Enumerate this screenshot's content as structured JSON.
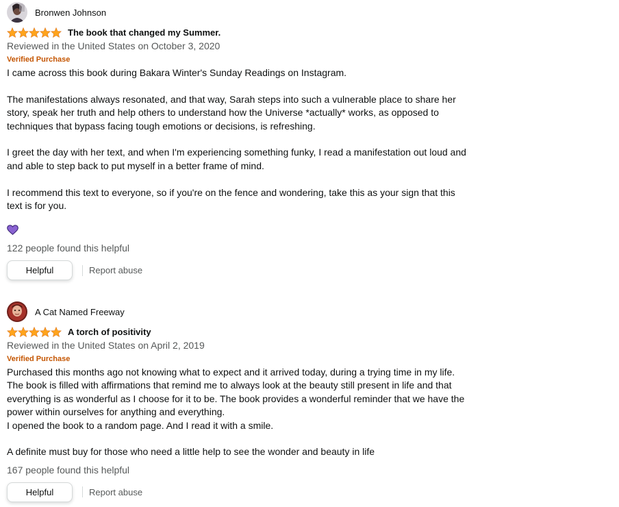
{
  "reviews": [
    {
      "reviewer": "Bronwen Johnson",
      "title": "The book that changed my Summer.",
      "rating": 5,
      "date": "Reviewed in the United States on October 3, 2020",
      "verified": "Verified Purchase",
      "paragraphs": [
        "I came across this book during Bakara Winter's Sunday Readings on Instagram.",
        "The manifestations always resonated, and that way, Sarah steps into such a vulnerable place to share her story, speak her truth and help others to understand how the Universe *actually* works, as opposed to techniques that bypass facing tough emotions or decisions, is refreshing.",
        "I greet the day with her text, and when I'm experiencing something funky, I read a manifestation out loud and and able to step back to put myself in a better frame of mind.",
        "I recommend this text to everyone, so if you're on the fence and wondering, take this as your sign that this text is for you."
      ],
      "helpful_count": "122 people found this helpful",
      "helpful_label": "Helpful",
      "report_label": "Report abuse"
    },
    {
      "reviewer": "A Cat Named Freeway",
      "title": "A torch of positivity",
      "rating": 5,
      "date": "Reviewed in the United States on April 2, 2019",
      "verified": "Verified Purchase",
      "paragraphs": [
        "Purchased this months ago not knowing what to expect and it arrived today, during a trying time in my life.\nThe book is filled with affirmations that remind me to always look at the beauty still present in life and that everything is as wonderful as I choose for it to be. The book provides a wonderful reminder that we have the power within ourselves for anything and everything.\nI opened the book to a random page. And I read it with a smile.",
        "A definite must buy for those who need a little help to see the wonder and beauty in life"
      ],
      "helpful_count": "167 people found this helpful",
      "helpful_label": "Helpful",
      "report_label": "Report abuse"
    }
  ],
  "icons": {
    "star": "star-icon",
    "heart": "heart-icon"
  },
  "colors": {
    "star": "#ffa41c",
    "star_stroke": "#de7921",
    "verified": "#c45500",
    "secondary_text": "#565959",
    "heart": "#8a63d2"
  }
}
